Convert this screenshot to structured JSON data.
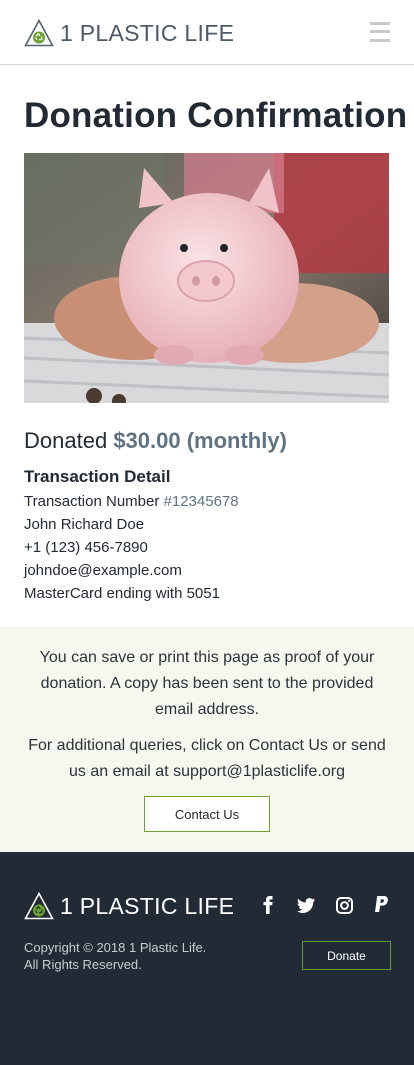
{
  "brand": {
    "name": "1 PLASTIC LIFE",
    "accent": "#6aa22d",
    "dark": "#222b35"
  },
  "header": {
    "menu_icon": "hamburger-menu-icon"
  },
  "main": {
    "title": "Donation Confirmation",
    "hero_image": "piggy-bank-photo",
    "donated_label": "Donated",
    "donated_amount": "$30.00 (monthly)",
    "transaction": {
      "heading": "Transaction Detail",
      "number_label": "Transaction Number",
      "number_value": "#12345678",
      "name": "John Richard Doe",
      "phone": "+1 (123) 456-7890",
      "email": "johndoe@example.com",
      "payment": "MasterCard ending with 5051"
    }
  },
  "notice": {
    "save_text": "You can save or print this page as proof of your donation. A copy has been sent to the provided email address.",
    "queries_text": "For additional queries, click on Contact Us or send us an email at support@1plasticlife.org",
    "contact_button": "Contact Us"
  },
  "footer": {
    "brand_name": "1 PLASTIC LIFE",
    "social_icons": [
      "facebook-icon",
      "twitter-icon",
      "instagram-icon",
      "paypal-icon"
    ],
    "copyright_line1": "Copyright © 2018 1 Plastic Life.",
    "copyright_line2": "All Rights Reserved.",
    "donate_button": "Donate"
  }
}
